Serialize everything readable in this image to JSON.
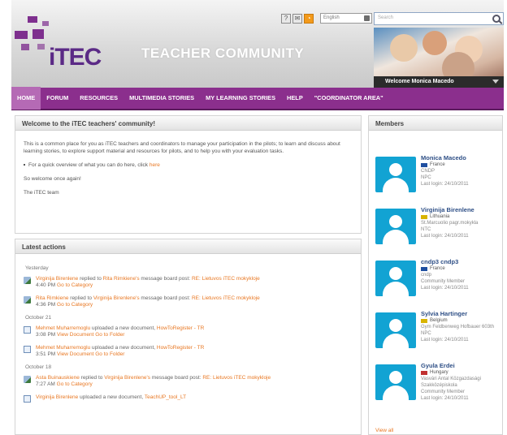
{
  "header": {
    "logo_text": "iTEC",
    "site_title": "TEACHER COMMUNITY",
    "language": "English",
    "search_placeholder": "Search",
    "welcome_user": "Welcome Monica Macedo"
  },
  "nav": {
    "items": [
      "HOME",
      "FORUM",
      "RESOURCES",
      "MULTIMEDIA STORIES",
      "MY LEARNING STORIES",
      "HELP",
      "\"COORDINATOR AREA\""
    ]
  },
  "welcome_panel": {
    "title": "Welcome to the iTEC teachers' community!",
    "intro": "This is a common place for you as iTEC teachers and coordinators to manage your participation in the pilots; to learn and discuss about learning stories, to explore support material and resources for pilots, and to help you with your evaluation tasks.",
    "bullet_text": "For a quick overview of what you can do here, click",
    "bullet_link": "here",
    "closing": "So welcome once again!",
    "signature": "The iTEC team"
  },
  "actions_panel": {
    "title": "Latest actions",
    "days": [
      {
        "label": "Yesterday",
        "items": [
          {
            "icon": "edit-icon",
            "actor": "Virginija Birenlene",
            "verb": "replied to",
            "target": "Rita Rimkiene's",
            "object": "message board post:",
            "post": "RE: Lietuvos iTEC mokykloje",
            "time": "4:40 PM",
            "extra_link": "Go to Category"
          },
          {
            "icon": "edit-icon",
            "actor": "Rita Rimkiene",
            "verb": "replied to",
            "target": "Virginija Birenlene's",
            "object": "message board post:",
            "post": "RE: Lietuvos iTEC mokykloje",
            "time": "4:36 PM",
            "extra_link": "Go to Category"
          }
        ]
      },
      {
        "label": "October 21",
        "items": [
          {
            "icon": "document-icon",
            "actor": "Mehmet Muharremoglu",
            "verb": "uploaded a new document,",
            "target": "",
            "object": "",
            "post": "HowToRegister - TR",
            "time": "3:08 PM",
            "extra_link": "View Document Go to Folder"
          },
          {
            "icon": "document-icon",
            "actor": "Mehmet Muharremoglu",
            "verb": "uploaded a new document,",
            "target": "",
            "object": "",
            "post": "HowToRegister - TR",
            "time": "3:51 PM",
            "extra_link": "View Document Go to Folder"
          }
        ]
      },
      {
        "label": "October 18",
        "items": [
          {
            "icon": "edit-icon",
            "actor": "Asta Buinauskiene",
            "verb": "replied to",
            "target": "Virginija Birenlene's",
            "object": "message board post:",
            "post": "RE: Lietuvos iTEC mokykloje",
            "time": "7:27 AM",
            "extra_link": "Go to Category"
          },
          {
            "icon": "document-icon",
            "actor": "Virginija Birenlene",
            "verb": "uploaded a new document,",
            "target": "",
            "object": "",
            "post": "TeachUP_tool_LT",
            "time": "",
            "extra_link": ""
          }
        ]
      }
    ]
  },
  "members_panel": {
    "title": "Members",
    "members": [
      {
        "name": "Monica Macedo",
        "country": "France",
        "flag_color": "#1f4fa0",
        "org": "CNDP",
        "role": "NPC",
        "last_login": "Last login: 24/10/2011"
      },
      {
        "name": "Virginija Birenlene",
        "country": "Lithuania",
        "flag_color": "#d8b400",
        "org": "St.Marcuolio pagr.mokykla",
        "role": "NTC",
        "last_login": "Last login: 24/10/2011"
      },
      {
        "name": "cndp3 cndp3",
        "country": "France",
        "flag_color": "#1f4fa0",
        "org": "cndp",
        "role": "Community Member",
        "last_login": "Last login: 24/10/2011"
      },
      {
        "name": "Sylvia Hartinger",
        "country": "Belgium",
        "flag_color": "#d8b400",
        "org": "Gym Feldbenweg Hofbauer 603th",
        "role": "NPC",
        "last_login": "Last login: 24/10/2011"
      },
      {
        "name": "Gyula Erdei",
        "country": "Hungary",
        "flag_color": "#c03030",
        "org": "Vasvári Antal Közgazdasági Szakközépiskola",
        "role": "Community Member",
        "last_login": "Last login: 24/10/2011"
      }
    ],
    "view_all": "View all"
  }
}
